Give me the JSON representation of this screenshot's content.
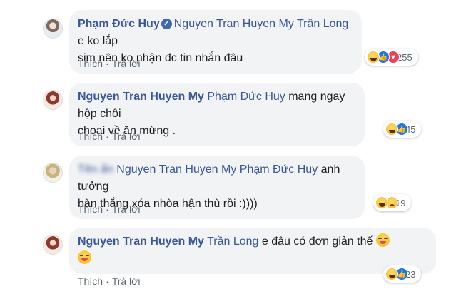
{
  "comments": [
    {
      "author": "Phạm Đức Huy",
      "verified": true,
      "tags": [
        "Nguyen Tran Huyen My",
        "Trần Long"
      ],
      "text_line1": " e ko lắp",
      "text_line2": "sim nên ko nhận đc tin nhắn đâu",
      "reactions": [
        "haha",
        "like",
        "love"
      ],
      "reaction_count": "255",
      "like_label": "Thích",
      "reply_label": "Trả lời"
    },
    {
      "author": "Nguyen Tran Huyen My",
      "tags": [
        "Phạm Đức Huy"
      ],
      "text_line1": " mang ngay hộp chôi",
      "text_line2": "choai về ăn mừng .",
      "reactions": [
        "haha",
        "like"
      ],
      "reaction_count": "45",
      "like_label": "Thích",
      "reply_label": "Trả lời"
    },
    {
      "author_blurred": "Tên ẩn",
      "tags": [
        "Nguyen Tran Huyen My",
        "Phạm Đức Huy"
      ],
      "text_line1": " anh tưởng",
      "text_line2": "bàn thắng xóa nhòa hận thù rồi :))))",
      "reactions": [
        "haha",
        "sad"
      ],
      "reaction_count": "19",
      "like_label": "Thích",
      "reply_label": "Trả lời"
    },
    {
      "author": "Nguyen Tran Huyen My",
      "tags": [
        "Trần Long"
      ],
      "text_line1": " e đâu có đơn giản thế",
      "reactions": [
        "haha",
        "like"
      ],
      "reaction_count": "23",
      "like_label": "Thích",
      "reply_label": "Trả lời"
    }
  ],
  "icons": {
    "verified": "checkmark-badge-icon",
    "haha": "haha-reaction-icon",
    "like": "like-reaction-icon",
    "love": "love-reaction-icon",
    "sad": "sad-reaction-icon",
    "emoji": "tongue-out-emoji-icon"
  },
  "colors": {
    "name_blue": "#385898",
    "bubble_bg": "#f2f3f5",
    "meta_gray": "#606770",
    "like_blue": "#1877f2",
    "love_red": "#f33e58"
  }
}
